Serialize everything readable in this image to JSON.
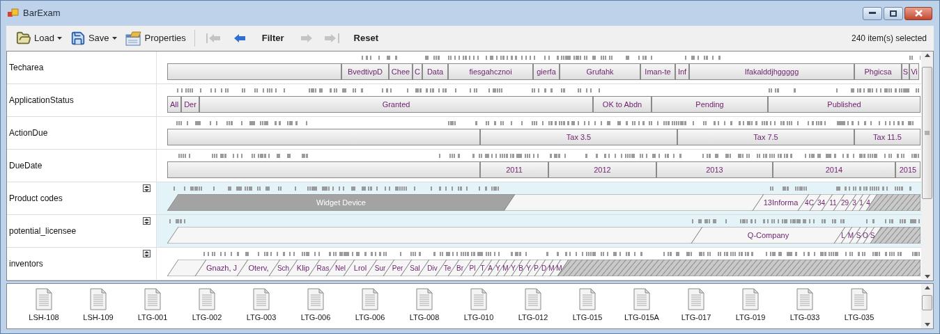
{
  "window": {
    "title": "BarExam"
  },
  "toolbar": {
    "items": [
      {
        "kind": "load",
        "label": "Load",
        "dropdown": true
      },
      {
        "kind": "save",
        "label": "Save",
        "dropdown": true
      },
      {
        "kind": "properties",
        "label": "Properties",
        "dropdown": false
      }
    ],
    "nav": [
      {
        "kind": "first",
        "disabled": true
      },
      {
        "kind": "back",
        "disabled": false
      },
      {
        "kind": "text",
        "label": "Filter",
        "disabled": false
      },
      {
        "kind": "forward",
        "disabled": true
      },
      {
        "kind": "last",
        "disabled": true
      },
      {
        "kind": "text",
        "label": "Reset",
        "disabled": false
      }
    ],
    "status": "240 item(s) selected"
  },
  "rows": [
    {
      "label": "Techarea",
      "kind": "flat",
      "toggle": false,
      "highlighted": false,
      "segments": [
        "BvedtivpD",
        "Chee",
        "C",
        "Data",
        "fiesgahcznoi",
        "gierfa",
        "Grufahk",
        "Iman-te",
        "Inf",
        "Ifakalddjhggggg",
        "Phgicsa",
        "S",
        "Vi"
      ]
    },
    {
      "label": "ApplicationStatus",
      "kind": "flat",
      "toggle": false,
      "highlighted": false,
      "segments": [
        "All",
        "Der",
        "Granted",
        "OK to Abdn",
        "Pending",
        "Published"
      ]
    },
    {
      "label": "ActionDue",
      "kind": "flat",
      "toggle": false,
      "highlighted": false,
      "segments": [
        "Tax 3.5",
        "Tax 7.5",
        "Tax 11.5"
      ]
    },
    {
      "label": "DueDate",
      "kind": "flat",
      "toggle": false,
      "highlighted": false,
      "segments": [
        "2011",
        "2012",
        "2013",
        "2014",
        "2015"
      ]
    },
    {
      "label": "Product codes",
      "kind": "slanted",
      "toggle": true,
      "highlighted": true,
      "segments": [
        "Widget Device",
        "13Informa",
        "4C",
        "34",
        "11",
        "29",
        "3",
        "1",
        "4"
      ]
    },
    {
      "label": "potential_licensee",
      "kind": "slanted",
      "toggle": true,
      "highlighted": true,
      "segments": [
        "Q-Company",
        "L",
        "M",
        "S",
        "O",
        "S"
      ]
    },
    {
      "label": "inventors",
      "kind": "slanted",
      "toggle": true,
      "highlighted": false,
      "segments": [
        "Gnazh, J",
        "Oterv,",
        "Sch",
        "Klip",
        "Ras",
        "Nel",
        "Lrol",
        "Sur",
        "Per",
        "Sal",
        "Div",
        "Te",
        "Br",
        "Pl",
        "T",
        "A",
        "Y",
        "M",
        "Y",
        "B",
        "Y",
        "P",
        "D",
        "M",
        "M"
      ]
    }
  ],
  "files": [
    "LSH-108",
    "LSH-109",
    "LTG-001",
    "LTG-002",
    "LTG-003",
    "LTG-006",
    "LTG-006",
    "LTG-008",
    "LTG-010",
    "LTG-012",
    "LTG-015",
    "LTG-015A",
    "LTG-017",
    "LTG-019",
    "LTG-033",
    "LTG-035"
  ]
}
